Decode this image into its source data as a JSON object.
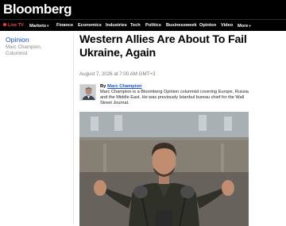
{
  "brand": {
    "logo": "Bloomberg"
  },
  "nav": {
    "live_label": "Live TV",
    "items": [
      {
        "label": "Markets",
        "has_menu": true
      },
      {
        "label": "Finance",
        "has_menu": false
      },
      {
        "label": "Economics",
        "has_menu": false
      },
      {
        "label": "Industries",
        "has_menu": false
      },
      {
        "label": "Tech",
        "has_menu": false
      },
      {
        "label": "Politics",
        "has_menu": false
      },
      {
        "label": "Businessweek",
        "has_menu": false
      },
      {
        "label": "Opinion",
        "has_menu": false
      },
      {
        "label": "Video",
        "has_menu": false
      },
      {
        "label": "More",
        "has_menu": true
      }
    ],
    "chevron_glyph": "▾"
  },
  "sidebar": {
    "section": "Opinion",
    "author_name": "Marc Champion,",
    "author_role": "Columnist"
  },
  "article": {
    "headline": "Western Allies Are About To Fail Ukraine, Again",
    "dateline": "August 7, 2026 at 7:00 AM GMT+3",
    "byline_prefix": "By",
    "byline_name": "Marc Champion",
    "bio": "Marc Champion is a Bloomberg Opinion columnist covering Europe, Russia and the Middle East. He was previously Istanbul bureau chief for the Wall Street Journal."
  },
  "colors": {
    "masthead_bg": "#000000",
    "accent_link": "#1a4fd6",
    "live_red": "#ff3b2f"
  },
  "icons": {
    "live": "live-dot-icon",
    "menu": "chevron-down-icon"
  }
}
